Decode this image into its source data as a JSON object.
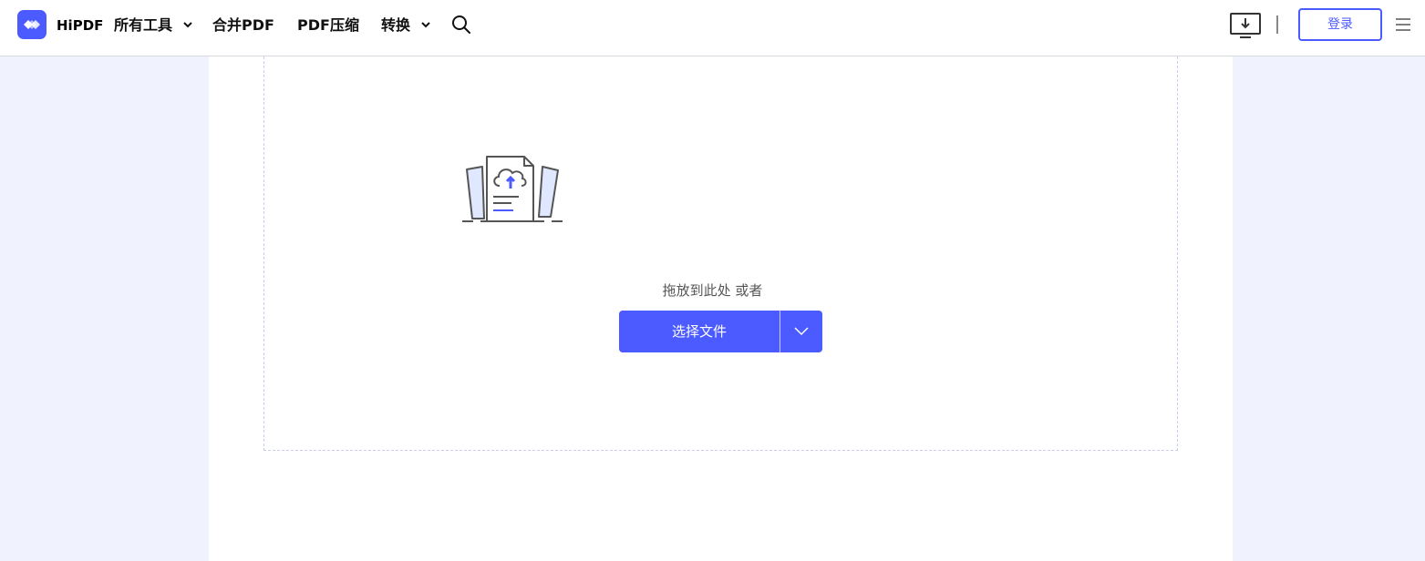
{
  "header": {
    "brand": "HiPDF",
    "nav": [
      {
        "label": "所有工具",
        "has_dropdown": true
      },
      {
        "label": "合并PDF",
        "has_dropdown": false
      },
      {
        "label": "PDF压缩",
        "has_dropdown": false
      },
      {
        "label": "转换",
        "has_dropdown": true
      }
    ],
    "icons": {
      "logo": "hipdf-logo-icon",
      "search": "search-icon",
      "download": "desktop-download-icon",
      "menu": "hamburger-menu-icon"
    },
    "login_label": "登录"
  },
  "upload": {
    "illustration": "cloud-upload-document-icon",
    "drop_text": "拖放到此处 或者",
    "choose_file_label": "选择文件",
    "dropdown_icon": "chevron-down-icon"
  },
  "colors": {
    "accent": "#4c5bff",
    "background": "#f0f2fe",
    "panel": "#ffffff"
  }
}
